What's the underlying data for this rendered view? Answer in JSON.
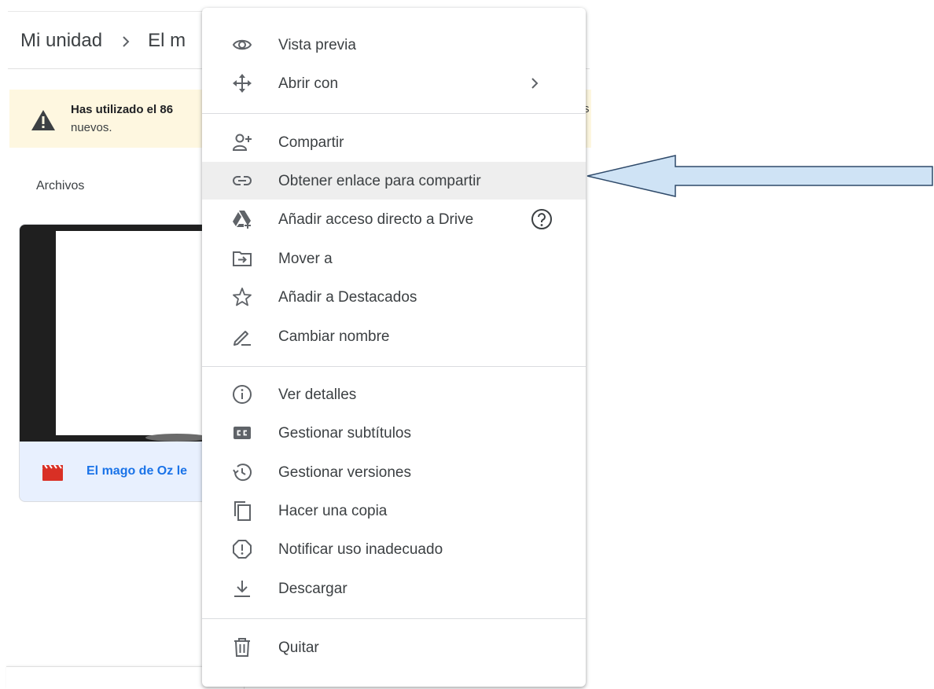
{
  "breadcrumb": {
    "root": "Mi unidad",
    "current": "El m"
  },
  "banner": {
    "line1": "Has utilizado el 86",
    "line2": "nuevos.",
    "trail": "s"
  },
  "section_title": "Archivos",
  "file_card": {
    "name": "El mago de Oz le"
  },
  "context_menu": {
    "preview": "Vista previa",
    "open_with": "Abrir con",
    "share": "Compartir",
    "get_link": "Obtener enlace para compartir",
    "add_shortcut": "Añadir acceso directo a Drive",
    "move_to": "Mover a",
    "add_starred": "Añadir a Destacados",
    "rename": "Cambiar nombre",
    "details": "Ver detalles",
    "subtitles": "Gestionar subtítulos",
    "versions": "Gestionar versiones",
    "copy": "Hacer una copia",
    "report": "Notificar uso inadecuado",
    "download": "Descargar",
    "remove": "Quitar",
    "highlighted_item": "get_link"
  },
  "colors": {
    "menu_text": "#3c4043",
    "icon": "#5f6368",
    "highlight_bg": "#eeeeee",
    "banner_bg": "#fef7e0",
    "file_link": "#1a73e8",
    "video_icon": "#d93025",
    "arrow_fill": "#cfe3f5",
    "arrow_stroke": "#2f4a6a"
  },
  "icons": {
    "preview": "eye-icon",
    "open_with": "move-arrows-icon",
    "share": "person-add-icon",
    "get_link": "link-icon",
    "add_shortcut": "drive-shortcut-icon",
    "move_to": "folder-move-icon",
    "add_starred": "star-icon",
    "rename": "pencil-icon",
    "details": "info-icon",
    "subtitles": "closed-caption-icon",
    "versions": "history-icon",
    "copy": "copy-icon",
    "report": "report-icon",
    "download": "download-icon",
    "remove": "trash-icon"
  }
}
